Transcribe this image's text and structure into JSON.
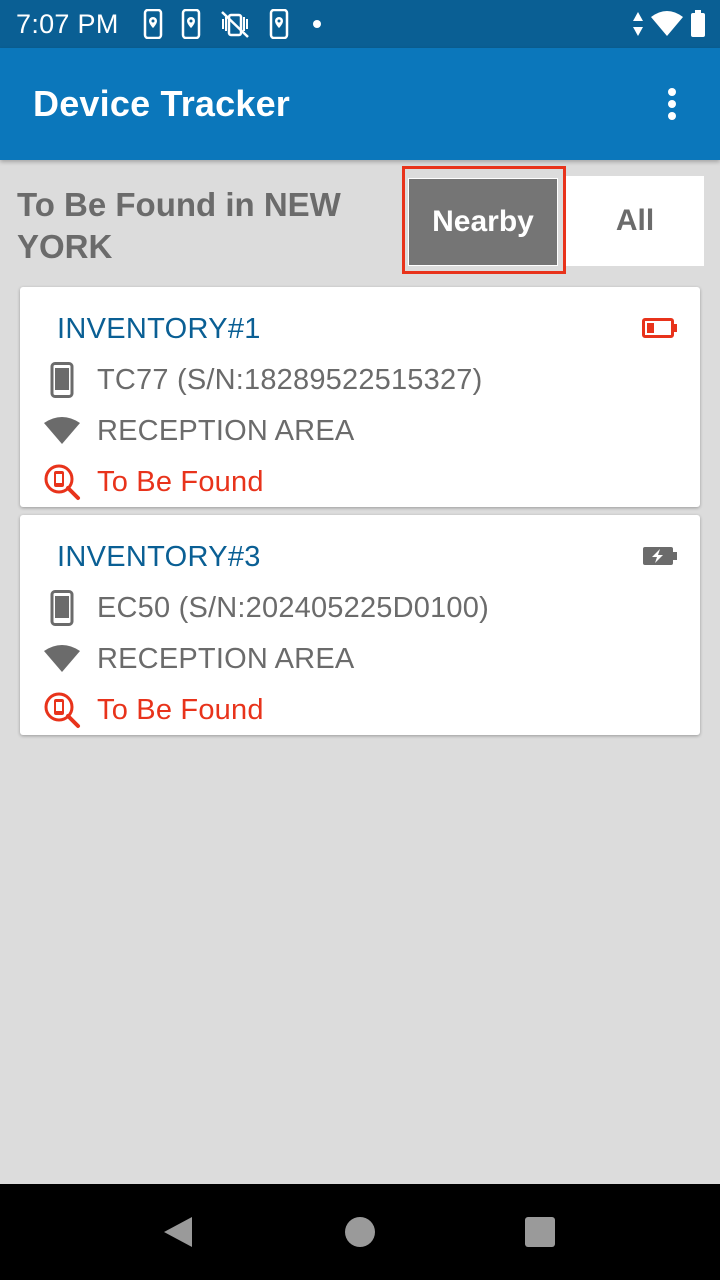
{
  "status_bar": {
    "time": "7:07 PM",
    "left_icons": [
      "location-phone-icon",
      "location-phone-icon",
      "vibrate-off-icon",
      "location-phone-icon",
      "dot-icon"
    ],
    "right_icons": [
      "data-arrows-icon",
      "wifi-icon",
      "battery-icon"
    ],
    "wifi_badge": "5"
  },
  "app_bar": {
    "title": "Device Tracker",
    "menu_icon": "overflow-menu-icon"
  },
  "header": {
    "title": "To Be Found in NEW YORK",
    "toggle": {
      "options": [
        "Nearby",
        "All"
      ],
      "selected": "Nearby"
    }
  },
  "devices": [
    {
      "name": "INVENTORY#1",
      "battery_status": "low",
      "model": "TC77 (S/N:18289522515327)",
      "location": "RECEPTION AREA",
      "status": "To Be Found"
    },
    {
      "name": "INVENTORY#3",
      "battery_status": "charging",
      "model": "EC50 (S/N:202405225D0100)",
      "location": "RECEPTION AREA",
      "status": "To Be Found"
    }
  ],
  "colors": {
    "status_bar": "#0a5f94",
    "app_bar": "#0b77bb",
    "accent_red": "#e8331b",
    "title_blue": "#0a5f94",
    "gray_text": "#6b6b6b",
    "background": "#dcdcdc"
  },
  "nav_bar": {
    "buttons": [
      "back-icon",
      "home-icon",
      "recents-icon"
    ]
  }
}
